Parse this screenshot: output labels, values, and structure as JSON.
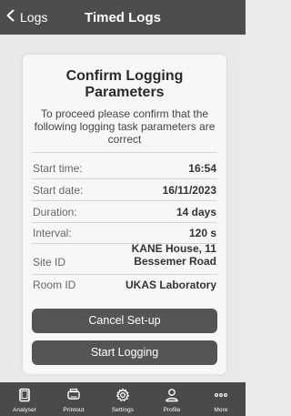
{
  "header": {
    "back_label": "Logs",
    "title": "Timed Logs"
  },
  "card": {
    "title_line1": "Confirm Logging",
    "title_line2": "Parameters",
    "description": "To proceed please confirm that the following logging task parameters are correct",
    "rows": [
      {
        "label": "Start time:",
        "value": "16:54"
      },
      {
        "label": "Start date:",
        "value": "16/11/2023"
      },
      {
        "label": "Duration:",
        "value": "14 days"
      },
      {
        "label": "Interval:",
        "value": "120 s"
      },
      {
        "label": "Site ID",
        "value_line1": "KANE House, 11",
        "value_line2": "Bessemer Road"
      },
      {
        "label": "Room ID",
        "value": "UKAS Laboratory"
      }
    ],
    "cancel_label": "Cancel Set-up",
    "start_label": "Start Logging"
  },
  "tabs": [
    {
      "label": "Analyser",
      "icon": "tablet-icon"
    },
    {
      "label": "Printout",
      "icon": "printer-icon"
    },
    {
      "label": "Settings",
      "icon": "gear-icon"
    },
    {
      "label": "Profile",
      "icon": "user-icon"
    },
    {
      "label": "More",
      "icon": "more-dots-icon"
    }
  ],
  "colors": {
    "header_bg": "#4d4d4d",
    "tabbar_bg": "#4a4a4a",
    "button_bg": "#555555",
    "card_bg": "#f7f7f7"
  }
}
